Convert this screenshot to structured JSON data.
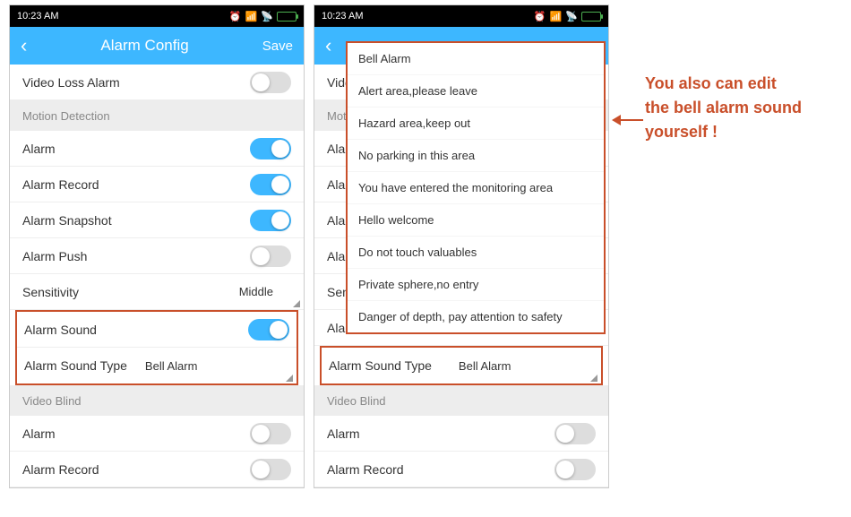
{
  "statusBar": {
    "time": "10:23 AM"
  },
  "header": {
    "title": "Alarm Config",
    "save": "Save"
  },
  "rows": {
    "videoLoss": "Video Loss Alarm",
    "alarm": "Alarm",
    "alarmRecord": "Alarm Record",
    "alarmSnapshot": "Alarm Snapshot",
    "alarmPush": "Alarm Push",
    "sensitivity": "Sensitivity",
    "sensitivityValue": "Middle",
    "alarmSound": "Alarm Sound",
    "alarmSoundType": "Alarm Sound Type",
    "alarmSoundTypeValue": "Bell Alarm"
  },
  "sections": {
    "motionDetection": "Motion Detection",
    "videoBlind": "Video Blind"
  },
  "dropdown": {
    "items": [
      "Bell Alarm",
      "Alert area,please leave",
      "Hazard area,keep out",
      "No parking in this area",
      "You have entered the monitoring area",
      "Hello welcome",
      "Do not touch valuables",
      "Private sphere,no entry",
      "Danger of depth, pay attention to safety"
    ]
  },
  "annotation": {
    "line1": "You also can edit",
    "line2": "the bell alarm sound",
    "line3": "yourself !"
  }
}
